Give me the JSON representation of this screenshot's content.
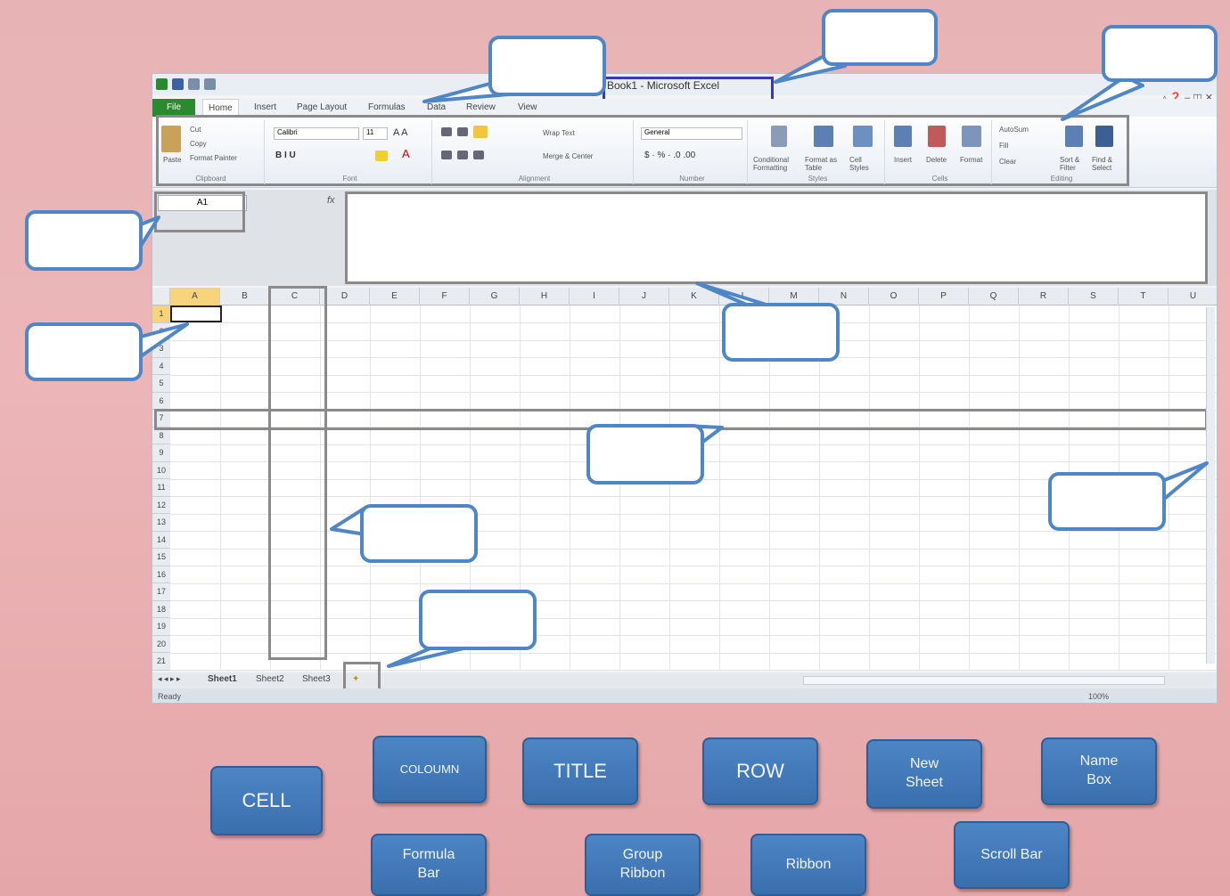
{
  "window": {
    "title": "Book1 - Microsoft Excel"
  },
  "tabs": [
    "File",
    "Home",
    "Insert",
    "Page Layout",
    "Formulas",
    "Data",
    "Review",
    "View"
  ],
  "ribbon": {
    "clipboard": {
      "paste": "Paste",
      "cut": "Cut",
      "copy": "Copy",
      "format_painter": "Format Painter",
      "group": "Clipboard"
    },
    "font": {
      "name": "Calibri",
      "size": "11",
      "group": "Font"
    },
    "alignment": {
      "wrap": "Wrap Text",
      "merge": "Merge & Center",
      "group": "Alignment"
    },
    "number": {
      "format": "General",
      "group": "Number"
    },
    "styles": {
      "conditional": "Conditional Formatting",
      "format_table": "Format as Table",
      "cell_styles": "Cell Styles",
      "group": "Styles"
    },
    "cells": {
      "insert": "Insert",
      "delete": "Delete",
      "format": "Format",
      "group": "Cells"
    },
    "editing": {
      "autosum": "AutoSum",
      "fill": "Fill",
      "clear": "Clear",
      "sort": "Sort & Filter",
      "find": "Find & Select",
      "group": "Editing"
    }
  },
  "namebox": {
    "value": "A1"
  },
  "formula": {
    "fx": "fx"
  },
  "columns": [
    "A",
    "B",
    "C",
    "D",
    "E",
    "F",
    "G",
    "H",
    "I",
    "J",
    "K",
    "L",
    "M",
    "N",
    "O",
    "P",
    "Q",
    "R",
    "S",
    "T",
    "U"
  ],
  "rows": [
    "1",
    "2",
    "3",
    "4",
    "5",
    "6",
    "7",
    "8",
    "9",
    "10",
    "11",
    "12",
    "13",
    "14",
    "15",
    "16",
    "17",
    "18",
    "19",
    "20",
    "21"
  ],
  "sheets": [
    "Sheet1",
    "Sheet2",
    "Sheet3"
  ],
  "status": {
    "ready": "Ready",
    "zoom": "100%"
  },
  "terms": {
    "cell": "CELL",
    "column": "COLOUMN",
    "title": "TITLE",
    "row": "ROW",
    "new_sheet": "New\nSheet",
    "name_box": "Name\nBox",
    "formula_bar": "Formula\nBar",
    "group_ribbon": "Group\nRibbon",
    "ribbon": "Ribbon",
    "scroll_bar": "Scroll Bar"
  },
  "colors": {
    "callout_border": "#4f86c6",
    "term_fill": "#4d85c5",
    "file_tab": "#2a8a2e",
    "title_box": "#3b3ba8"
  }
}
